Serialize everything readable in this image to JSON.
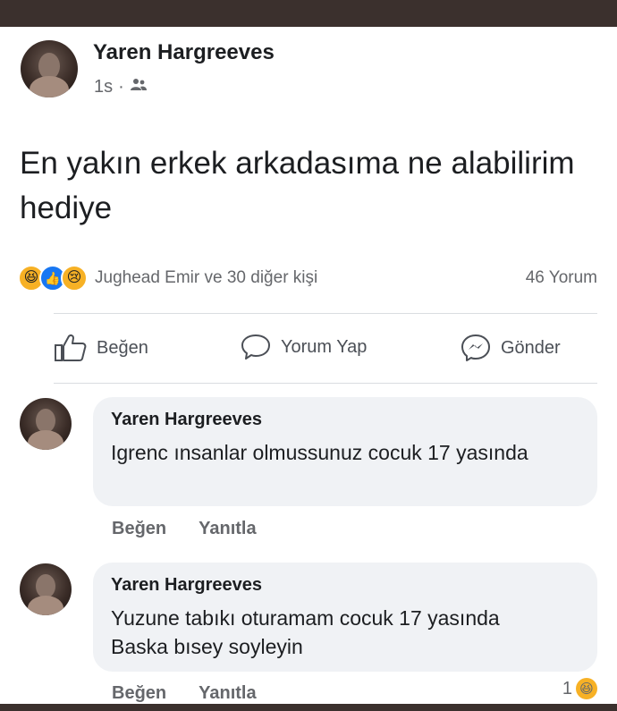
{
  "post": {
    "author": "Yaren Hargreeves",
    "time": "1s",
    "separator": "·",
    "privacy_icon": "friends-icon",
    "text": "En yakın erkek arkadasıma ne alabilirim hediye",
    "reactions": {
      "icons": [
        "haha-icon",
        "like-icon",
        "sad-icon"
      ],
      "summary": "Jughead Emir ve 30 diğer kişi"
    },
    "comment_count": "46 Yorum"
  },
  "actions": {
    "like": "Beğen",
    "comment": "Yorum Yap",
    "send": "Gönder"
  },
  "comments": [
    {
      "author": "Yaren Hargreeves",
      "text": "Igrenc ınsanlar olmussunuz cocuk 17 yasında",
      "like": "Beğen",
      "reply": "Yanıtla"
    },
    {
      "author": "Yaren Hargreeves",
      "text": "Yuzune tabıkı oturamam cocuk 17 yasında Baska bısey soyleyin",
      "like": "Beğen",
      "reply": "Yanıtla",
      "reaction_count": "1"
    }
  ],
  "colors": {
    "frame": "#3b302d",
    "bubble": "#f0f2f5",
    "secondary_text": "#65676b",
    "like_blue": "#1877f2",
    "reaction_yellow": "#f7b125"
  }
}
